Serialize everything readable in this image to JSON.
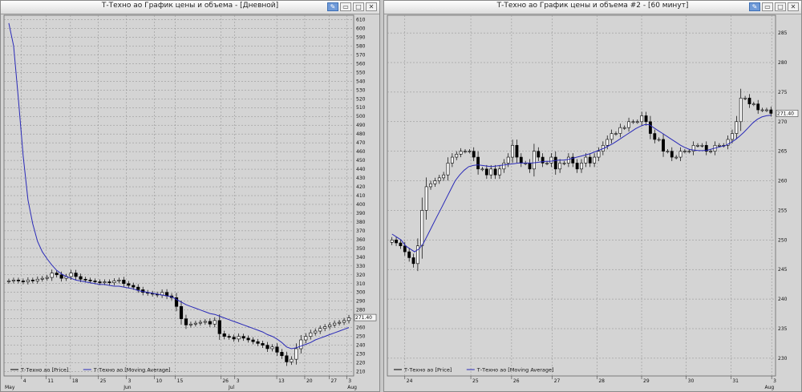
{
  "colors": {
    "ma_line": "#2a2ab8",
    "candle_up": "#ffffff",
    "candle_down": "#000000",
    "grid": "#8c8c8c",
    "plot_bg": "#d4d4d4"
  },
  "windows": [
    {
      "title": "Т-Техно ао График цены и объема - [Дневной]",
      "buttons": [
        "pin-icon",
        "restore-icon",
        "maximize-icon",
        "close-icon"
      ]
    },
    {
      "title": "Т-Техно ао График цены и объема #2 - [60 минут]",
      "buttons": [
        "pin-icon",
        "restore-icon",
        "maximize-icon",
        "close-icon"
      ]
    }
  ],
  "chart_data": [
    {
      "type": "candlestick",
      "timeframe": "Дневной",
      "y_ticks": [
        "210",
        "220",
        "230",
        "240",
        "250",
        "260",
        "270",
        "280",
        "290",
        "300",
        "310",
        "320",
        "330",
        "340",
        "350",
        "360",
        "370",
        "380",
        "390",
        "400",
        "410",
        "420",
        "430",
        "440",
        "450",
        "460",
        "470",
        "480",
        "490",
        "500",
        "510",
        "520",
        "530",
        "540",
        "550",
        "560",
        "570",
        "580",
        "590",
        "600",
        "610"
      ],
      "ylim": [
        205,
        615
      ],
      "x_ticks": [
        "4",
        "11",
        "18",
        "25",
        "3",
        "10",
        "15",
        "26",
        "3",
        "13",
        "20",
        "27",
        "3"
      ],
      "month_labels": [
        "May",
        "Jun",
        "Jul",
        "Aug"
      ],
      "last_price_label": "271.40",
      "legend": [
        "Т-Техно ао [Price]",
        "Т-Техно ао [Moving Average]"
      ],
      "series": [
        {
          "name": "Т-Техно ао [Price]",
          "values": [
            313,
            314,
            313,
            312,
            314,
            313,
            315,
            316,
            317,
            322,
            320,
            316,
            318,
            322,
            318,
            315,
            314,
            313,
            312,
            311,
            312,
            311,
            313,
            314,
            310,
            308,
            306,
            303,
            300,
            299,
            298,
            297,
            300,
            296,
            294,
            284,
            270,
            263,
            264,
            265,
            266,
            267,
            264,
            268,
            253,
            250,
            249,
            247,
            250,
            248,
            246,
            244,
            242,
            240,
            236,
            238,
            232,
            228,
            221,
            224,
            236,
            246,
            250,
            254,
            256,
            259,
            261,
            263,
            265,
            266,
            268,
            271
          ]
        },
        {
          "name": "Т-Техно ао [Moving Average]",
          "values": [
            606,
            580,
            520,
            455,
            405,
            378,
            358,
            346,
            338,
            331,
            325,
            321,
            318,
            316,
            314,
            313,
            312,
            311,
            310,
            309,
            309,
            308,
            307,
            307,
            306,
            305,
            304,
            302,
            301,
            300,
            299,
            298,
            297,
            296,
            295,
            292,
            289,
            286,
            284,
            282,
            280,
            278,
            276,
            275,
            273,
            271,
            269,
            267,
            265,
            263,
            261,
            259,
            257,
            255,
            252,
            250,
            247,
            243,
            238,
            236,
            237,
            239,
            241,
            243,
            246,
            248,
            250,
            252,
            254,
            256,
            258,
            260
          ]
        }
      ]
    },
    {
      "type": "candlestick",
      "timeframe": "60 минут",
      "y_ticks": [
        "230",
        "235",
        "240",
        "245",
        "250",
        "255",
        "260",
        "265",
        "270",
        "275",
        "280",
        "285"
      ],
      "ylim": [
        227,
        288
      ],
      "x_ticks": [
        "24",
        "25",
        "26",
        "27",
        "28",
        "29",
        "30",
        "31",
        "3"
      ],
      "month_labels": [
        "Aug"
      ],
      "last_price_label": "271.40",
      "legend": [
        "Т-Техно ао [Price]",
        "Т-Техно ао [Moving Average]"
      ],
      "series": [
        {
          "name": "Т-Техно ао [Price]",
          "values": [
            250,
            249.5,
            249,
            248,
            247,
            246,
            249,
            255,
            259,
            259.5,
            260,
            260.5,
            261,
            263,
            264,
            264.5,
            265,
            265,
            265,
            264,
            262,
            262,
            261,
            262,
            261,
            262,
            263,
            264,
            266,
            264,
            263,
            263,
            262,
            265,
            264,
            263,
            263,
            264,
            262,
            263,
            263,
            264,
            263,
            262,
            263,
            264,
            263,
            264,
            265,
            266,
            267,
            268,
            268,
            269,
            269,
            270,
            270,
            270,
            271,
            270,
            268,
            267,
            267,
            265,
            265,
            264,
            264,
            265,
            265,
            265,
            266,
            266,
            266,
            265,
            265,
            266,
            266,
            266,
            267,
            268,
            270,
            274,
            274,
            273,
            273,
            272,
            272,
            272,
            271.4
          ]
        },
        {
          "name": "Т-Техно ао [Moving Average]",
          "values": [
            251,
            250.5,
            250,
            249,
            248.5,
            248,
            248.5,
            249.5,
            251,
            252.5,
            254,
            255.5,
            257,
            258.5,
            260,
            261,
            261.8,
            262.4,
            262.6,
            262.7,
            262.6,
            262.5,
            262.4,
            262.5,
            262.6,
            262.7,
            262.8,
            262.9,
            263,
            263,
            263,
            263,
            263.1,
            263.2,
            263.3,
            263.3,
            263.4,
            263.5,
            263.5,
            263.6,
            263.8,
            264,
            264.2,
            264.4,
            264.6,
            264.9,
            265.2,
            265.5,
            265.9,
            266.3,
            266.8,
            267.3,
            267.8,
            268.3,
            268.8,
            269.2,
            269.5,
            269.5,
            269,
            268.5,
            268,
            267.5,
            267,
            266.5,
            266,
            265.6,
            265.3,
            265.2,
            265.1,
            265.1,
            265.2,
            265.4,
            265.6,
            265.8,
            266,
            266.4,
            266.9,
            267.5,
            268.2,
            269,
            269.8,
            270.4,
            270.8,
            271,
            271.1
          ]
        }
      ]
    }
  ]
}
